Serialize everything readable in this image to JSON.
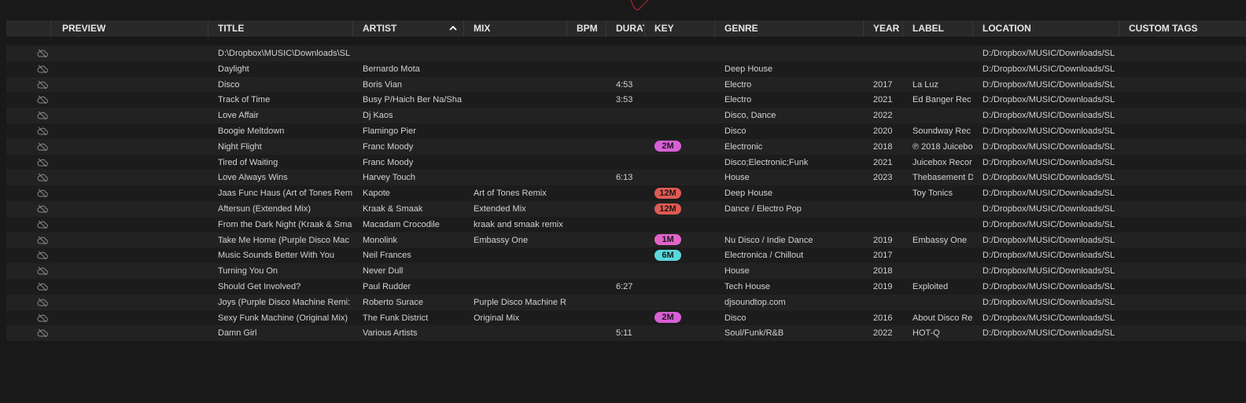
{
  "columns": {
    "preview": "PREVIEW",
    "title": "TITLE",
    "artist": "ARTIST",
    "mix": "MIX",
    "bpm": "BPM",
    "duration": "DURAT",
    "key": "KEY",
    "genre": "GENRE",
    "year": "YEAR",
    "label": "LABEL",
    "location": "LOCATION",
    "custom_tags": "CUSTOM TAGS"
  },
  "sort": {
    "column": "artist",
    "direction": "ascending",
    "icon": "chevron-up-icon"
  },
  "row_icon": "cloud-off-icon",
  "key_colors": {
    "2M": "#d85fd6",
    "12M": "#e05a54",
    "1M": "#e064c8",
    "6M": "#5ad8dc"
  },
  "rows": [
    {
      "title": "D:\\Dropbox\\MUSIC\\Downloads\\SL",
      "artist": "",
      "mix": "",
      "bpm": "",
      "duration": "",
      "key": "",
      "genre": "",
      "year": "",
      "label": "",
      "location": "D:/Dropbox/MUSIC/Downloads/SL"
    },
    {
      "title": "Daylight",
      "artist": "Bernardo Mota",
      "mix": "",
      "bpm": "",
      "duration": "",
      "key": "",
      "genre": "Deep House",
      "year": "",
      "label": "",
      "location": "D:/Dropbox/MUSIC/Downloads/SL"
    },
    {
      "title": "Disco",
      "artist": "Boris Vian",
      "mix": "",
      "bpm": "",
      "duration": "4:53",
      "key": "",
      "genre": "Electro",
      "year": "2017",
      "label": "La Luz",
      "location": "D:/Dropbox/MUSIC/Downloads/SL"
    },
    {
      "title": "Track of Time",
      "artist": "Busy P/Haich Ber Na/Sha",
      "mix": "",
      "bpm": "",
      "duration": "3:53",
      "key": "",
      "genre": "Electro",
      "year": "2021",
      "label": "Ed Banger Rec",
      "location": "D:/Dropbox/MUSIC/Downloads/SL"
    },
    {
      "title": "Love Affair",
      "artist": "Dj Kaos",
      "mix": "",
      "bpm": "",
      "duration": "",
      "key": "",
      "genre": "Disco, Dance",
      "year": "2022",
      "label": "",
      "location": "D:/Dropbox/MUSIC/Downloads/SL"
    },
    {
      "title": "Boogie Meltdown",
      "artist": "Flamingo Pier",
      "mix": "",
      "bpm": "",
      "duration": "",
      "key": "",
      "genre": "Disco",
      "year": "2020",
      "label": "Soundway Rec",
      "location": "D:/Dropbox/MUSIC/Downloads/SL"
    },
    {
      "title": "Night Flight",
      "artist": "Franc Moody",
      "mix": "",
      "bpm": "",
      "duration": "",
      "key": "2M",
      "genre": "Electronic",
      "year": "2018",
      "label": "℗ 2018 Juicebo",
      "location": "D:/Dropbox/MUSIC/Downloads/SL"
    },
    {
      "title": "Tired of Waiting",
      "artist": "Franc Moody",
      "mix": "",
      "bpm": "",
      "duration": "",
      "key": "",
      "genre": "Disco;Electronic;Funk",
      "year": "2021",
      "label": "Juicebox Recor",
      "location": "D:/Dropbox/MUSIC/Downloads/SL"
    },
    {
      "title": "Love Always Wins",
      "artist": "Harvey Touch",
      "mix": "",
      "bpm": "",
      "duration": "6:13",
      "key": "",
      "genre": "House",
      "year": "2023",
      "label": "Thebasement D",
      "location": "D:/Dropbox/MUSIC/Downloads/SL"
    },
    {
      "title": "Jaas Func Haus (Art of Tones Rem",
      "artist": "Kapote",
      "mix": "Art of Tones Remix",
      "bpm": "",
      "duration": "",
      "key": "12M",
      "genre": "Deep House",
      "year": "",
      "label": "Toy Tonics",
      "location": "D:/Dropbox/MUSIC/Downloads/SL"
    },
    {
      "title": "Aftersun (Extended Mix)",
      "artist": "Kraak & Smaak",
      "mix": "Extended Mix",
      "bpm": "",
      "duration": "",
      "key": "12M",
      "genre": "Dance / Electro Pop",
      "year": "",
      "label": "",
      "location": "D:/Dropbox/MUSIC/Downloads/SL"
    },
    {
      "title": "From the Dark Night (Kraak & Sma",
      "artist": "Macadam Crocodile",
      "mix": "kraak and smaak remix",
      "bpm": "",
      "duration": "",
      "key": "",
      "genre": "",
      "year": "",
      "label": "",
      "location": "D:/Dropbox/MUSIC/Downloads/SL"
    },
    {
      "title": "Take Me Home (Purple Disco Mac",
      "artist": "Monolink",
      "mix": "Embassy One",
      "bpm": "",
      "duration": "",
      "key": "1M",
      "genre": "Nu Disco / Indie Dance",
      "year": "2019",
      "label": "Embassy One",
      "location": "D:/Dropbox/MUSIC/Downloads/SL"
    },
    {
      "title": "Music Sounds Better With You",
      "artist": "Neil Frances",
      "mix": "",
      "bpm": "",
      "duration": "",
      "key": "6M",
      "genre": "Electronica / Chillout",
      "year": "2017",
      "label": "",
      "location": "D:/Dropbox/MUSIC/Downloads/SL"
    },
    {
      "title": "Turning You On",
      "artist": "Never Dull",
      "mix": "",
      "bpm": "",
      "duration": "",
      "key": "",
      "genre": "House",
      "year": "2018",
      "label": "",
      "location": "D:/Dropbox/MUSIC/Downloads/SL"
    },
    {
      "title": "Should Get Involved?",
      "artist": "Paul Rudder",
      "mix": "",
      "bpm": "",
      "duration": "6:27",
      "key": "",
      "genre": "Tech House",
      "year": "2019",
      "label": "Exploited",
      "location": "D:/Dropbox/MUSIC/Downloads/SL"
    },
    {
      "title": "Joys (Purple Disco Machine Remi:",
      "artist": "Roberto Surace",
      "mix": "Purple Disco Machine R",
      "bpm": "",
      "duration": "",
      "key": "",
      "genre": "djsoundtop.com",
      "year": "",
      "label": "",
      "location": "D:/Dropbox/MUSIC/Downloads/SL"
    },
    {
      "title": "Sexy Funk Machine (Original Mix)",
      "artist": "The Funk District",
      "mix": "Original Mix",
      "bpm": "",
      "duration": "",
      "key": "2M",
      "genre": "Disco",
      "year": "2016",
      "label": "About Disco Re",
      "location": "D:/Dropbox/MUSIC/Downloads/SL"
    },
    {
      "title": "Damn Girl",
      "artist": "Various Artists",
      "mix": "",
      "bpm": "",
      "duration": "5:11",
      "key": "",
      "genre": "Soul/Funk/R&B",
      "year": "2022",
      "label": "HOT-Q",
      "location": "D:/Dropbox/MUSIC/Downloads/SL"
    }
  ]
}
